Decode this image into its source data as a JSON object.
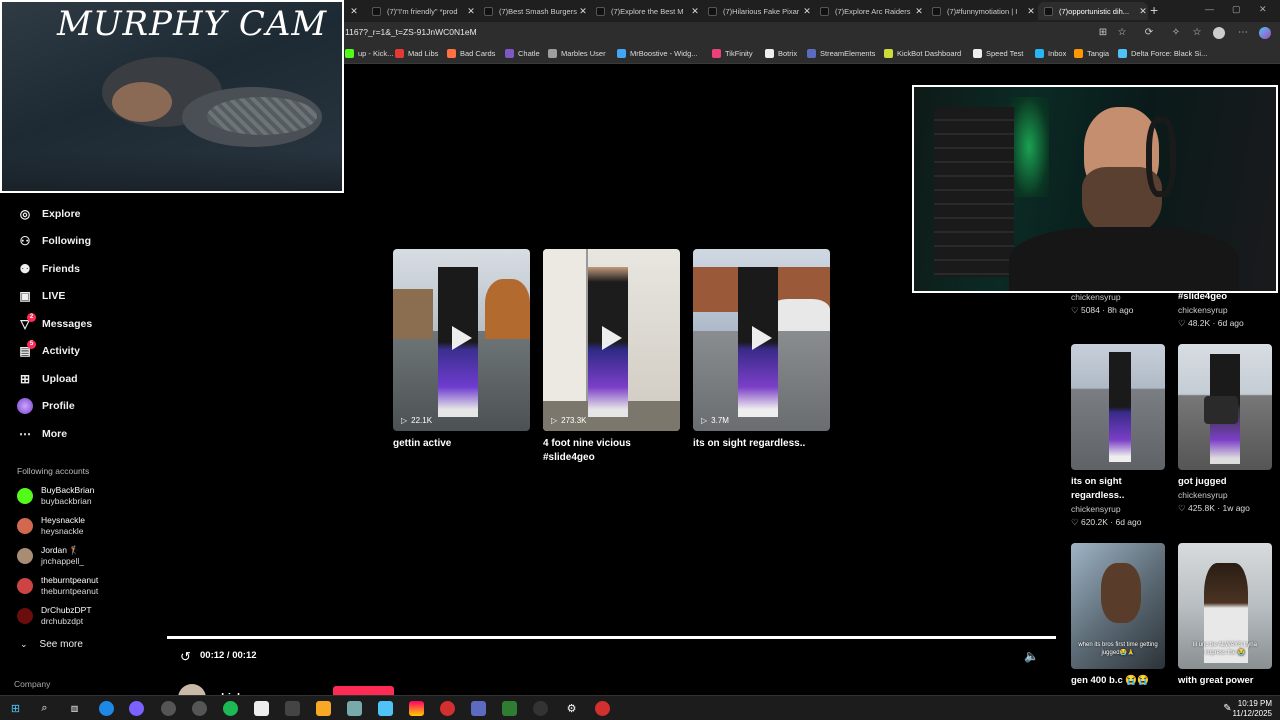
{
  "browser": {
    "tabs": [
      {
        "label": "(7)\"I'm friendly\" *prod"
      },
      {
        "label": "(7)Best Smash Burgers"
      },
      {
        "label": "(7)Explore the Best M"
      },
      {
        "label": "(7)Hilarious Fake Pixar"
      },
      {
        "label": "(7)Explore Arc Raiders"
      },
      {
        "label": "(7)#funnymotiation | I"
      },
      {
        "label": "(7)opportunistic dih..."
      }
    ],
    "new_tab": "+",
    "url": "1167?_r=1&_t=ZS-91JnWC0N1eM",
    "bookmarks": [
      {
        "label": "up - Kick...",
        "color": "#53fc18"
      },
      {
        "label": "Mad Libs",
        "color": "#e53935"
      },
      {
        "label": "Bad Cards",
        "color": "#ff7043"
      },
      {
        "label": "Chatle",
        "color": "#7e57c2"
      },
      {
        "label": "Marbles User",
        "color": "#9e9e9e"
      },
      {
        "label": "MrBoostive - Widg...",
        "color": "#42a5f5"
      },
      {
        "label": "TikFinity",
        "color": "#ec407a"
      },
      {
        "label": "Botrix",
        "color": "#eeeeee"
      },
      {
        "label": "StreamElements",
        "color": "#5c6bc0"
      },
      {
        "label": "KickBot Dashboard",
        "color": "#cddc39"
      },
      {
        "label": "Speed Test",
        "color": "#eeeeee"
      },
      {
        "label": "Inbox",
        "color": "#29b6f6"
      },
      {
        "label": "Tangia",
        "color": "#ff9800"
      },
      {
        "label": "Delta Force: Black Si...",
        "color": "#4fc3f7"
      }
    ]
  },
  "overlay": {
    "cam_title": "MURPHY CAM"
  },
  "sidebar": {
    "nav": [
      {
        "label": "Explore",
        "icon": "compass-icon",
        "glyph": "◎"
      },
      {
        "label": "Following",
        "icon": "following-icon",
        "glyph": "⚇"
      },
      {
        "label": "Friends",
        "icon": "friends-icon",
        "glyph": "⚉"
      },
      {
        "label": "LIVE",
        "icon": "live-icon",
        "glyph": "▣"
      },
      {
        "label": "Messages",
        "icon": "messages-icon",
        "glyph": "▽",
        "badge": "2"
      },
      {
        "label": "Activity",
        "icon": "activity-icon",
        "glyph": "▤",
        "badge": "5"
      },
      {
        "label": "Upload",
        "icon": "upload-icon",
        "glyph": "⊞"
      },
      {
        "label": "Profile",
        "icon": "profile-icon",
        "glyph": "●"
      },
      {
        "label": "More",
        "icon": "more-icon",
        "glyph": "⋯"
      }
    ],
    "following_heading": "Following accounts",
    "accounts": [
      {
        "name": "BuyBackBrian",
        "handle": "buybackbrian",
        "color": "#53fc18"
      },
      {
        "name": "Heysnackle",
        "handle": "heysnackle",
        "color": "#d2694f"
      },
      {
        "name": "Jordan 🏌",
        "handle": "jnchappell_",
        "color": "#a88c74"
      },
      {
        "name": "theburntpeanut",
        "handle": "theburntpeanut",
        "color": "#c44"
      },
      {
        "name": "DrChubzDPT",
        "handle": "drchubzdpt",
        "color": "#6a0d0d"
      }
    ],
    "see_more": "See more",
    "company": "Company"
  },
  "videos": [
    {
      "title": "gettin active",
      "views": "22.1K"
    },
    {
      "title": "4 foot nine vicious #slide4geo",
      "views": "273.3K"
    },
    {
      "title": "its on sight regardless..",
      "views": "3.7M"
    }
  ],
  "right_column": {
    "top": [
      {
        "title": "",
        "author": "chickensyrup",
        "meta": "♡ 5084 · 8h ago"
      },
      {
        "title": "#slide4geo",
        "author": "chickensyrup",
        "meta": "♡ 48.2K · 6d ago"
      }
    ],
    "cards": [
      {
        "title": "its on sight regardless..",
        "author": "chickensyrup",
        "meta": "♡ 620.2K · 6d ago"
      },
      {
        "title": "got jugged",
        "author": "chickensyrup",
        "meta": "♡ 425.8K · 1w ago"
      },
      {
        "title": "gen 400 b.c 😭😭",
        "author": "",
        "meta": ""
      },
      {
        "title": "with great power",
        "author": "",
        "meta": ""
      }
    ],
    "thumb_captions": [
      "when its bros first time getting jugged😭🙏",
      "lil unc be ALWAYS tryna impress the 😭"
    ]
  },
  "player": {
    "time": "00:12 / 00:12",
    "progress": 1.0,
    "author": "chickensyrup"
  },
  "taskbar": {
    "time": "10:19 PM",
    "date": "11/12/2025"
  }
}
